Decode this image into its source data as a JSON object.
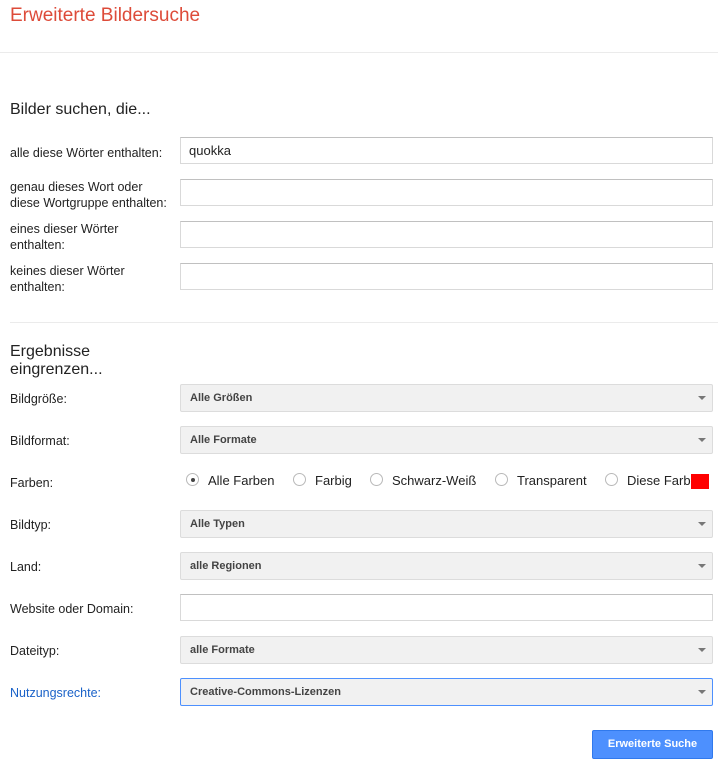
{
  "page_title": "Erweiterte Bildersuche",
  "find_section": {
    "title": "Bilder suchen, die...",
    "all_words": {
      "label": "alle diese Wörter enthalten:",
      "value": "quokka"
    },
    "exact_phrase": {
      "label_line1": "genau dieses Wort oder",
      "label_line2": "diese Wortgruppe enthalten:",
      "value": ""
    },
    "any_words": {
      "label_line1": "eines dieser Wörter",
      "label_line2": "enthalten:",
      "value": ""
    },
    "none_words": {
      "label_line1": "keines dieser Wörter",
      "label_line2": "enthalten:",
      "value": ""
    }
  },
  "narrow_section": {
    "title_line1": "Ergebnisse",
    "title_line2": "eingrenzen...",
    "image_size": {
      "label": "Bildgröße:",
      "value": "Alle Größen"
    },
    "aspect_ratio": {
      "label": "Bildformat:",
      "value": "Alle Formate"
    },
    "colors": {
      "label": "Farben:",
      "options": [
        "Alle Farben",
        "Farbig",
        "Schwarz-Weiß",
        "Transparent",
        "Diese Farbe:"
      ],
      "selected": "Alle Farben",
      "selected_color": "#ff0000"
    },
    "image_type": {
      "label": "Bildtyp:",
      "value": "Alle Typen"
    },
    "region": {
      "label": "Land:",
      "value": "alle Regionen"
    },
    "site": {
      "label": "Website oder Domain:",
      "value": ""
    },
    "file_type": {
      "label": "Dateityp:",
      "value": "alle Formate"
    },
    "usage_rights": {
      "label": "Nutzungsrechte:",
      "value": "Creative-Commons-Lizenzen"
    }
  },
  "submit_button": "Erweiterte Suche",
  "colors": {
    "title": "#dd4b39",
    "link": "#1a62c8",
    "button": "#4d90fe"
  }
}
